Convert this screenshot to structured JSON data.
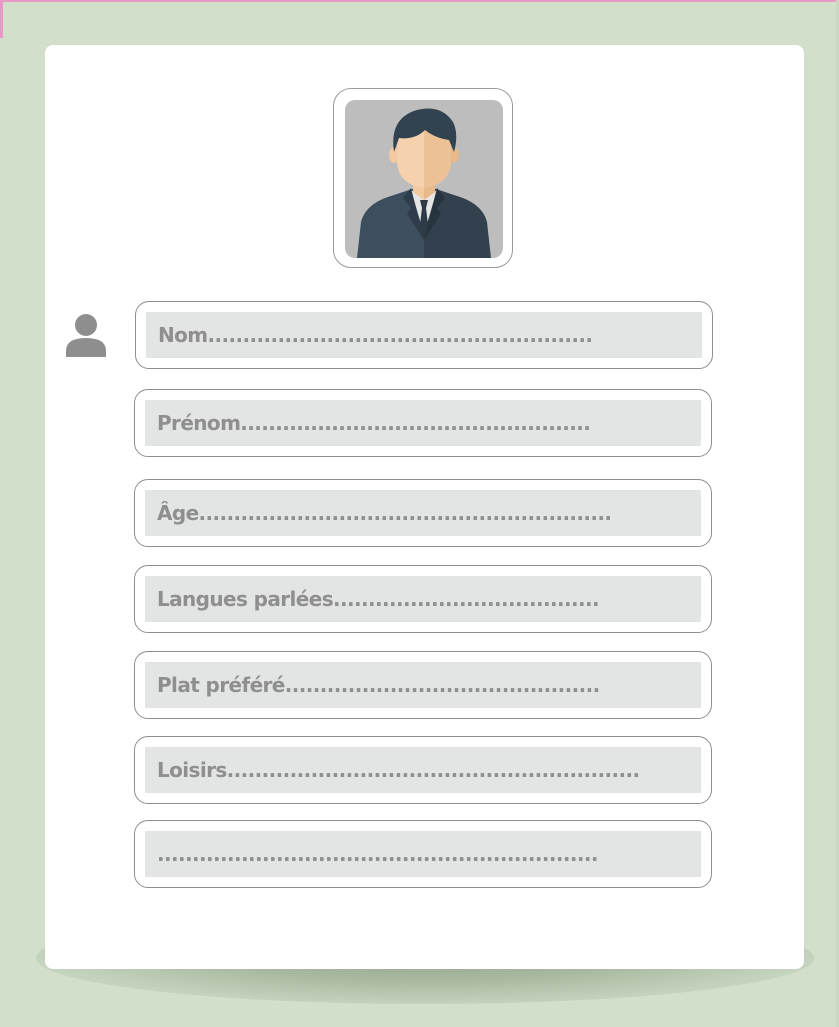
{
  "form": {
    "fields": [
      {
        "label": "Nom......................................................."
      },
      {
        "label": "Prénom.................................................."
      },
      {
        "label": "Âge..........................................................."
      },
      {
        "label": "Langues parlées......................................"
      },
      {
        "label": "Plat préféré............................................."
      },
      {
        "label": "Loisirs..........................................................."
      },
      {
        "label": "..............................................................."
      }
    ]
  },
  "icons": {
    "profile_photo": "businessman-avatar-icon",
    "field_marker": "person-icon"
  },
  "colors": {
    "background": "#d2dfcb",
    "card": "#ffffff",
    "field_fill": "#e3e4e4",
    "field_text": "#8f8f8f",
    "top_border": "#e79ac8"
  }
}
